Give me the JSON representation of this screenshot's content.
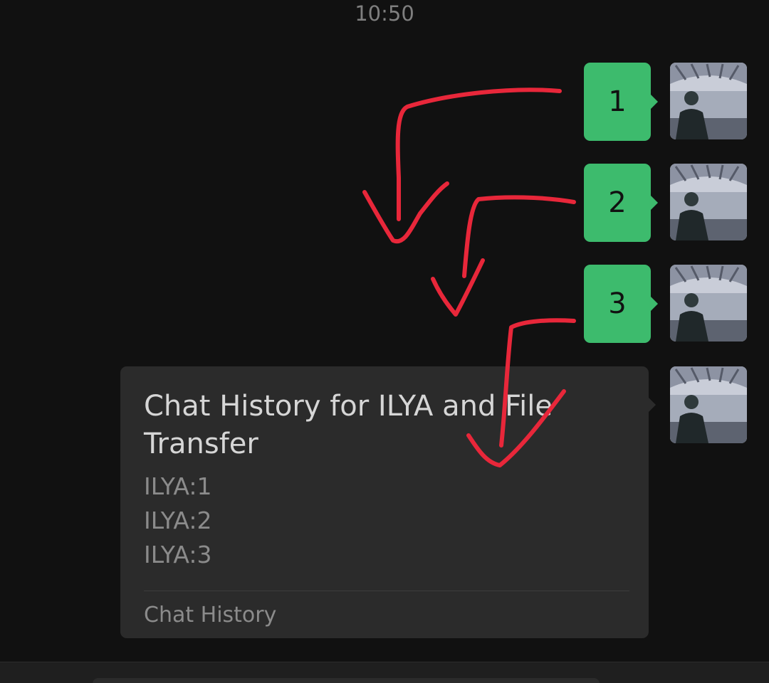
{
  "header": {
    "timestamp": "10:50"
  },
  "messages": [
    {
      "text": "1"
    },
    {
      "text": "2"
    },
    {
      "text": "3"
    }
  ],
  "forwarded_card": {
    "title": "Chat History for ILYA and File Transfer",
    "lines": [
      "ILYA:1",
      "ILYA:2",
      "ILYA:3"
    ],
    "footer": "Chat History"
  },
  "colors": {
    "background": "#111111",
    "bubble_green": "#3dbb6d",
    "card_background": "#2b2b2b",
    "annotation_red": "#e8273a"
  },
  "icons": {
    "avatar": "user-avatar-photo",
    "annotation": "red-hand-drawn-arrow"
  }
}
